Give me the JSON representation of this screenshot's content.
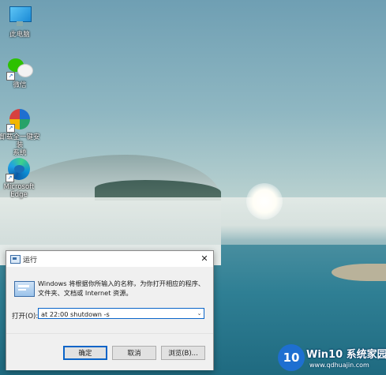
{
  "desktop": {
    "icons": [
      {
        "label": "此电脑",
        "icon": "this-pc-icon"
      },
      {
        "label": "微信",
        "icon": "wechat-icon"
      },
      {
        "label": "卸载全一键安装\n系统",
        "icon": "installer-app-icon"
      },
      {
        "label": "Microsoft\nEdge",
        "icon": "edge-icon"
      }
    ]
  },
  "run_dialog": {
    "title": "运行",
    "description": "Windows 将根据你所输入的名称，为你打开相应的程序、文件夹、文档或 Internet 资源。",
    "open_label": "打开(O):",
    "input_value": "at 22:00 shutdown -s",
    "buttons": {
      "ok": "确定",
      "cancel": "取消",
      "browse": "浏览(B)..."
    },
    "close_glyph": "✕",
    "dropdown_glyph": "⌄"
  },
  "watermark": {
    "logo_text": "10",
    "title": "Win10 系统家园",
    "url": "www.qdhuajin.com"
  },
  "colors": {
    "accent": "#0a64c8",
    "dialog_bg": "#f0f0f0"
  }
}
